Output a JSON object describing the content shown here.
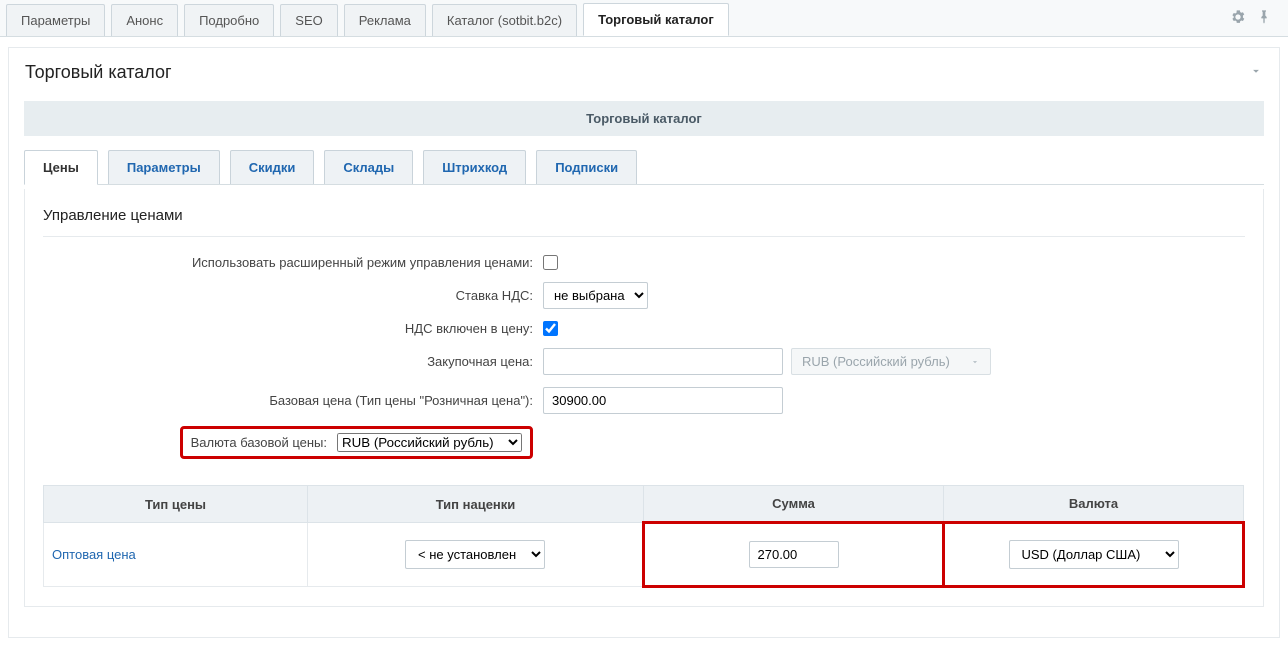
{
  "topTabs": {
    "params": "Параметры",
    "anons": "Анонс",
    "detail": "Подробно",
    "seo": "SEO",
    "reklama": "Реклама",
    "catalogSotbit": "Каталог (sotbit.b2c)",
    "tradeCatalog": "Торговый каталог"
  },
  "panelTitle": "Торговый каталог",
  "innerHeader": "Торговый каталог",
  "subTabs": {
    "prices": "Цены",
    "params": "Параметры",
    "discounts": "Скидки",
    "warehouses": "Склады",
    "barcode": "Штрихкод",
    "subscriptions": "Подписки"
  },
  "sectionTitle": "Управление ценами",
  "form": {
    "extendedModeLabel": "Использовать расширенный режим управления ценами:",
    "extendedModeChecked": false,
    "vatRateLabel": "Ставка НДС:",
    "vatRateValue": "не выбрана",
    "vatIncludedLabel": "НДС включен в цену:",
    "vatIncludedChecked": true,
    "purchasePriceLabel": "Закупочная цена:",
    "purchasePriceValue": "",
    "purchaseCurrency": "RUB (Российский рубль)",
    "basePriceLabel": "Базовая цена (Тип цены \"Розничная цена\"):",
    "basePriceValue": "30900.00",
    "baseCurrencyLabel": "Валюта базовой цены:",
    "baseCurrencyValue": "RUB (Российский рубль)"
  },
  "priceTable": {
    "headers": {
      "type": "Тип цены",
      "markup": "Тип наценки",
      "sum": "Сумма",
      "currency": "Валюта"
    },
    "row": {
      "typeName": "Оптовая цена",
      "markupValue": "< не установлен >",
      "sumValue": "270.00",
      "currencyValue": "USD (Доллар США)"
    }
  }
}
